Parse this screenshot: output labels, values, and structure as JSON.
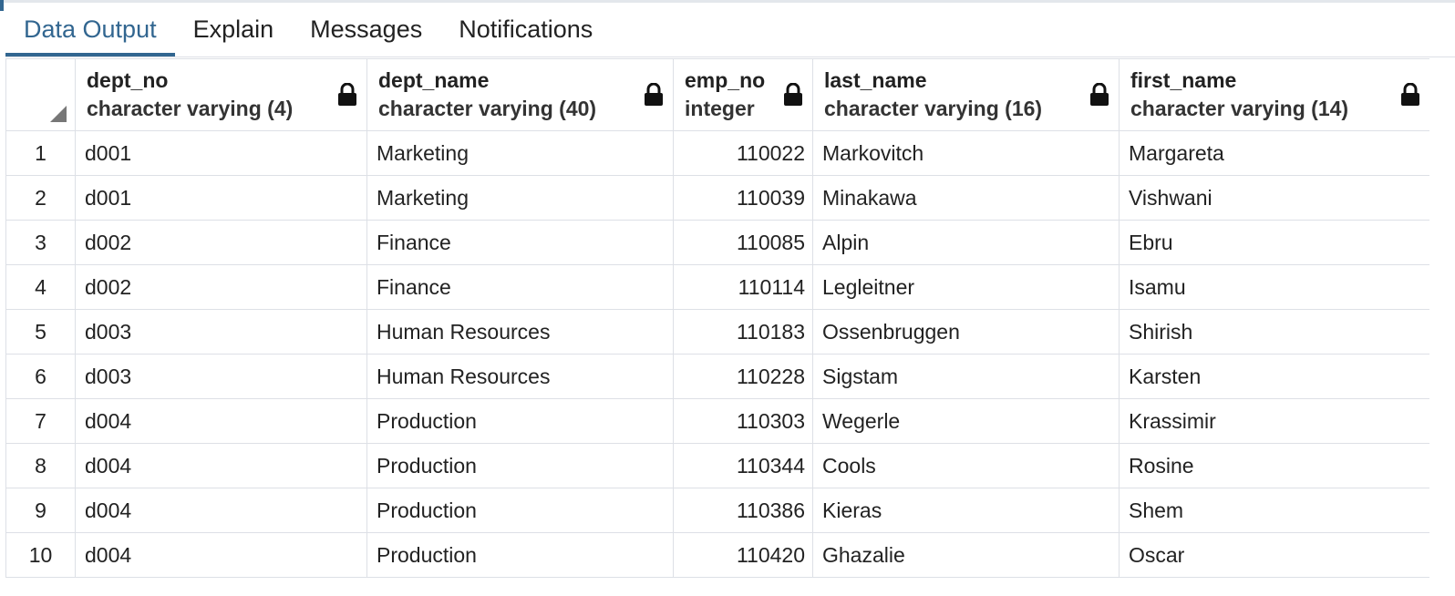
{
  "tabs": [
    {
      "label": "Data Output",
      "active": true
    },
    {
      "label": "Explain",
      "active": false
    },
    {
      "label": "Messages",
      "active": false
    },
    {
      "label": "Notifications",
      "active": false
    }
  ],
  "grid": {
    "columns": [
      {
        "name": "dept_no",
        "type": "character varying (4)",
        "icon": "lock-icon"
      },
      {
        "name": "dept_name",
        "type": "character varying (40)",
        "icon": "lock-icon"
      },
      {
        "name": "emp_no",
        "type": "integer",
        "icon": "lock-icon"
      },
      {
        "name": "last_name",
        "type": "character varying (16)",
        "icon": "lock-icon"
      },
      {
        "name": "first_name",
        "type": "character varying (14)",
        "icon": "lock-icon"
      }
    ],
    "rows": [
      {
        "n": "1",
        "dept_no": "d001",
        "dept_name": "Marketing",
        "emp_no": "110022",
        "last_name": "Markovitch",
        "first_name": "Margareta"
      },
      {
        "n": "2",
        "dept_no": "d001",
        "dept_name": "Marketing",
        "emp_no": "110039",
        "last_name": "Minakawa",
        "first_name": "Vishwani"
      },
      {
        "n": "3",
        "dept_no": "d002",
        "dept_name": "Finance",
        "emp_no": "110085",
        "last_name": "Alpin",
        "first_name": "Ebru"
      },
      {
        "n": "4",
        "dept_no": "d002",
        "dept_name": "Finance",
        "emp_no": "110114",
        "last_name": "Legleitner",
        "first_name": "Isamu"
      },
      {
        "n": "5",
        "dept_no": "d003",
        "dept_name": "Human Resources",
        "emp_no": "110183",
        "last_name": "Ossenbruggen",
        "first_name": "Shirish"
      },
      {
        "n": "6",
        "dept_no": "d003",
        "dept_name": "Human Resources",
        "emp_no": "110228",
        "last_name": "Sigstam",
        "first_name": "Karsten"
      },
      {
        "n": "7",
        "dept_no": "d004",
        "dept_name": "Production",
        "emp_no": "110303",
        "last_name": "Wegerle",
        "first_name": "Krassimir"
      },
      {
        "n": "8",
        "dept_no": "d004",
        "dept_name": "Production",
        "emp_no": "110344",
        "last_name": "Cools",
        "first_name": "Rosine"
      },
      {
        "n": "9",
        "dept_no": "d004",
        "dept_name": "Production",
        "emp_no": "110386",
        "last_name": "Kieras",
        "first_name": "Shem"
      },
      {
        "n": "10",
        "dept_no": "d004",
        "dept_name": "Production",
        "emp_no": "110420",
        "last_name": "Ghazalie",
        "first_name": "Oscar"
      }
    ]
  },
  "colors": {
    "accent": "#326690",
    "grid_border": "#dde0e6",
    "text": "#222222"
  }
}
